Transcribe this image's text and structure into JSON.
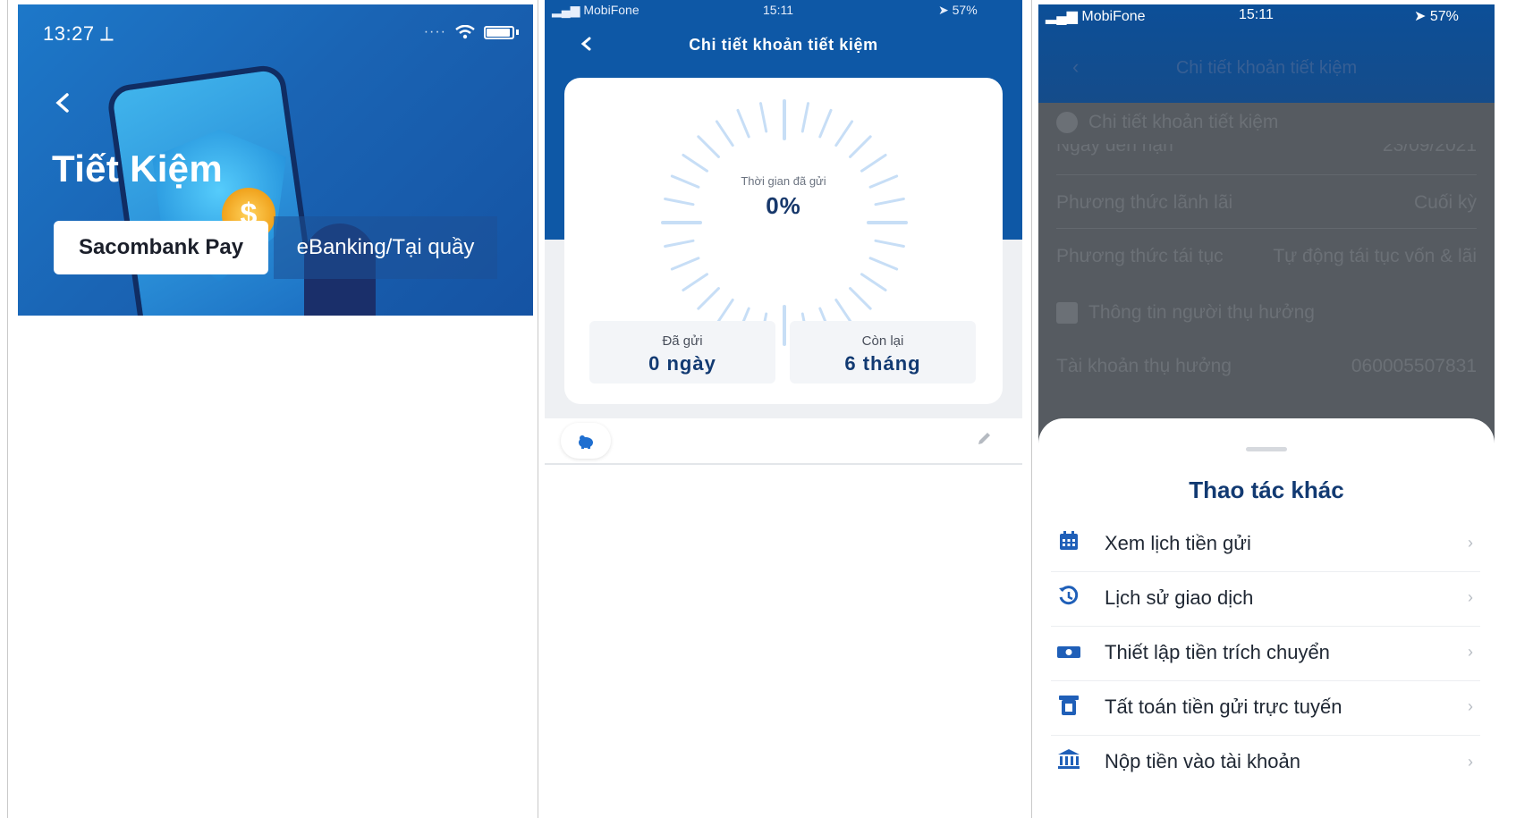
{
  "panel1": {
    "time": "13:27 ⟂",
    "back_icon": "chevron-left-icon",
    "title": "Tiết Kiệm",
    "coin_symbol": "$",
    "tabs": [
      {
        "label": "Sacombank Pay",
        "active": true
      },
      {
        "label": "eBanking/Tại quầy",
        "active": false
      }
    ],
    "colors": {
      "header": "#1a64b4"
    }
  },
  "panel2": {
    "status": {
      "carrier": "MobiFone",
      "time": "15:11",
      "battery": "57%"
    },
    "title": "Chi tiết khoản tiết kiệm",
    "progress": {
      "label": "Thời gian đã gửi",
      "value": "0%",
      "fraction": 0
    },
    "stats": [
      {
        "label": "Đã gửi",
        "value": "0 ngày"
      },
      {
        "label": "Còn lại",
        "value": "6 tháng"
      }
    ],
    "colors": {
      "header": "#0e58a6",
      "accent": "#17386b",
      "ring": "#c7def6"
    }
  },
  "panel3": {
    "status": {
      "carrier": "MobiFone",
      "time": "15:11",
      "battery": "57%"
    },
    "dim_title": "Chi tiết khoản tiết kiệm",
    "dim_rows": [
      {
        "label": "Chi tiết khoản tiết kiệm",
        "value": ""
      },
      {
        "label": "Ngày đến hạn",
        "value": "23/09/2021"
      },
      {
        "label": "Phương thức lãnh lãi",
        "value": "Cuối kỳ"
      },
      {
        "label": "Phương thức tái tục",
        "value": "Tự động tái tục vốn & lãi"
      },
      {
        "label": "Thông tin người thụ hưởng",
        "value": ""
      },
      {
        "label": "Tài khoản thụ hưởng",
        "value": "060005507831"
      }
    ],
    "sheet": {
      "title": "Thao tác khác",
      "items": [
        {
          "label": "Xem lịch tiền gửi",
          "icon": "calendar-icon"
        },
        {
          "label": "Lịch sử giao dịch",
          "icon": "history-icon"
        },
        {
          "label": "Thiết lập tiền trích chuyển",
          "icon": "money-transfer-icon"
        },
        {
          "label": "Tất toán tiền gửi trực tuyến",
          "icon": "settle-deposit-icon"
        },
        {
          "label": "Nộp tiền vào tài khoản",
          "icon": "bank-icon"
        }
      ]
    },
    "colors": {
      "accent": "#1f5fb8",
      "title": "#123a72"
    }
  }
}
